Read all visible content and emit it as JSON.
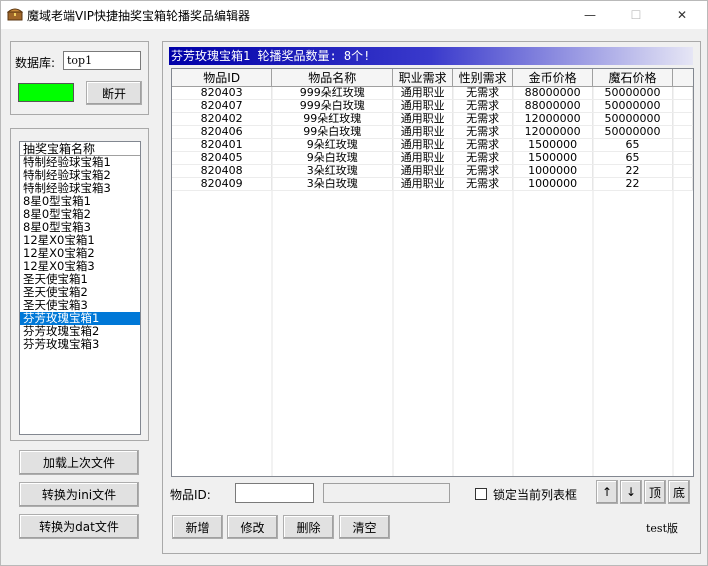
{
  "window": {
    "title": "魔域老端VIP快捷抽奖宝箱轮播奖品编辑器",
    "minimize_glyph": "—",
    "maximize_glyph": "☐",
    "close_glyph": "✕"
  },
  "connection": {
    "db_label": "数据库:",
    "db_value": "top1",
    "status_color": "#00ff00",
    "disconnect_label": "断开"
  },
  "boxes": {
    "header": "抽奖宝箱名称",
    "items": [
      "特制经验球宝箱1",
      "特制经验球宝箱2",
      "特制经验球宝箱3",
      "8星0型宝箱1",
      "8星0型宝箱2",
      "8星0型宝箱3",
      "12星X0宝箱1",
      "12星X0宝箱2",
      "12星X0宝箱3",
      "圣天使宝箱1",
      "圣天使宝箱2",
      "圣天使宝箱3",
      "芬芳玫瑰宝箱1",
      "芬芳玫瑰宝箱2",
      "芬芳玫瑰宝箱3"
    ],
    "selected_index": 12,
    "load_last_label": "加载上次文件",
    "to_ini_label": "转换为ini文件",
    "to_dat_label": "转换为dat文件"
  },
  "grid": {
    "banner": "芬芳玫瑰宝箱1 轮播奖品数量: 8个!",
    "columns": [
      "物品ID",
      "物品名称",
      "职业需求",
      "性别需求",
      "金币价格",
      "魔石价格"
    ],
    "rows": [
      [
        "820403",
        "999朵红玫瑰",
        "通用职业",
        "无需求",
        "88000000",
        "50000000"
      ],
      [
        "820407",
        "999朵白玫瑰",
        "通用职业",
        "无需求",
        "88000000",
        "50000000"
      ],
      [
        "820402",
        "99朵红玫瑰",
        "通用职业",
        "无需求",
        "12000000",
        "50000000"
      ],
      [
        "820406",
        "99朵白玫瑰",
        "通用职业",
        "无需求",
        "12000000",
        "50000000"
      ],
      [
        "820401",
        "9朵红玫瑰",
        "通用职业",
        "无需求",
        "1500000",
        "65"
      ],
      [
        "820405",
        "9朵白玫瑰",
        "通用职业",
        "无需求",
        "1500000",
        "65"
      ],
      [
        "820408",
        "3朵红玫瑰",
        "通用职业",
        "无需求",
        "1000000",
        "22"
      ],
      [
        "820409",
        "3朵白玫瑰",
        "通用职业",
        "无需求",
        "1000000",
        "22"
      ]
    ]
  },
  "editor": {
    "item_id_label": "物品ID:",
    "item_id_value": "",
    "item_name_value": "",
    "lock_label": "锁定当前列表框",
    "lock_checked": false,
    "up_label": "↑",
    "down_label": "↓",
    "top_label": "顶",
    "bottom_label": "底",
    "add_label": "新增",
    "edit_label": "修改",
    "delete_label": "删除",
    "clear_label": "清空",
    "version_label": "test版"
  }
}
